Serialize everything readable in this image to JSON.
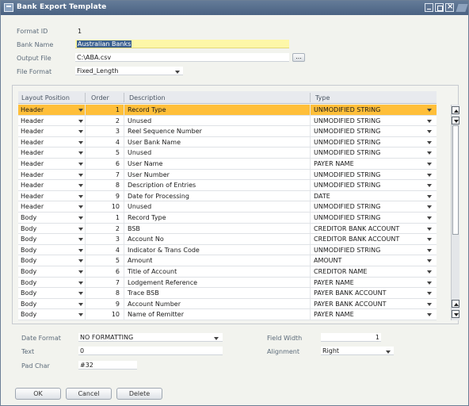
{
  "window": {
    "title": "Bank Export Template"
  },
  "header": {
    "format_id": {
      "label": "Format ID",
      "value": "1"
    },
    "bank_name": {
      "label": "Bank Name",
      "value": "Australian Banks"
    },
    "output_file": {
      "label": "Output File",
      "value": "C:\\ABA.csv",
      "browse_label": "..."
    },
    "file_format": {
      "label": "File Format",
      "value": "Fixed_Length"
    }
  },
  "grid": {
    "columns": [
      "Layout Position",
      "Order",
      "Description",
      "Type"
    ],
    "rows": [
      {
        "position": "Header",
        "order": "1",
        "description": "Record Type",
        "type": "UNMODIFIED STRING"
      },
      {
        "position": "Header",
        "order": "2",
        "description": "Unused",
        "type": "UNMODIFIED STRING"
      },
      {
        "position": "Header",
        "order": "3",
        "description": "Reel Sequence Number",
        "type": "UNMODIFIED STRING"
      },
      {
        "position": "Header",
        "order": "4",
        "description": "User Bank Name",
        "type": "UNMODIFIED STRING"
      },
      {
        "position": "Header",
        "order": "5",
        "description": "Unused",
        "type": "UNMODIFIED STRING"
      },
      {
        "position": "Header",
        "order": "6",
        "description": "User Name",
        "type": "PAYER NAME"
      },
      {
        "position": "Header",
        "order": "7",
        "description": "User Number",
        "type": "UNMODIFIED STRING"
      },
      {
        "position": "Header",
        "order": "8",
        "description": "Description of Entries",
        "type": "UNMODIFIED STRING"
      },
      {
        "position": "Header",
        "order": "9",
        "description": "Date for Processing",
        "type": "DATE"
      },
      {
        "position": "Header",
        "order": "10",
        "description": "Unused",
        "type": "UNMODIFIED STRING"
      },
      {
        "position": "Body",
        "order": "1",
        "description": "Record Type",
        "type": "UNMODIFIED STRING"
      },
      {
        "position": "Body",
        "order": "2",
        "description": "BSB",
        "type": "CREDITOR BANK ACCOUNT"
      },
      {
        "position": "Body",
        "order": "3",
        "description": "Account No",
        "type": "CREDITOR BANK ACCOUNT"
      },
      {
        "position": "Body",
        "order": "4",
        "description": "Indicator & Trans Code",
        "type": "UNMODIFIED STRING"
      },
      {
        "position": "Body",
        "order": "5",
        "description": "Amount",
        "type": "AMOUNT"
      },
      {
        "position": "Body",
        "order": "6",
        "description": "Title of Account",
        "type": "CREDITOR NAME"
      },
      {
        "position": "Body",
        "order": "7",
        "description": "Lodgement Reference",
        "type": "PAYER NAME"
      },
      {
        "position": "Body",
        "order": "8",
        "description": "Trace BSB",
        "type": "PAYER BANK ACCOUNT"
      },
      {
        "position": "Body",
        "order": "9",
        "description": "Account Number",
        "type": "PAYER BANK ACCOUNT"
      },
      {
        "position": "Body",
        "order": "10",
        "description": "Name of Remitter",
        "type": "PAYER NAME"
      }
    ],
    "selected_row": 0
  },
  "details": {
    "date_format": {
      "label": "Date Format",
      "value": "NO FORMATTING"
    },
    "text": {
      "label": "Text",
      "value": "0"
    },
    "pad_char": {
      "label": "Pad Char",
      "value": "#32"
    },
    "field_width": {
      "label": "Field Width",
      "value": "1"
    },
    "alignment": {
      "label": "Alignment",
      "value": "Right"
    }
  },
  "buttons": {
    "ok": "OK",
    "cancel": "Cancel",
    "delete": "Delete"
  },
  "colors": {
    "titlebar": "#4f6787",
    "selected_row": "#ffbf3a",
    "bank_name_field": "#fdf7a8"
  },
  "icons": {
    "window": "window-icon",
    "minimize": "minimize-icon",
    "maximize": "maximize-icon",
    "close": "close-icon",
    "dropdown": "chevron-down-icon",
    "scroll_up": "scroll-up-icon",
    "scroll_down": "scroll-down-icon"
  }
}
